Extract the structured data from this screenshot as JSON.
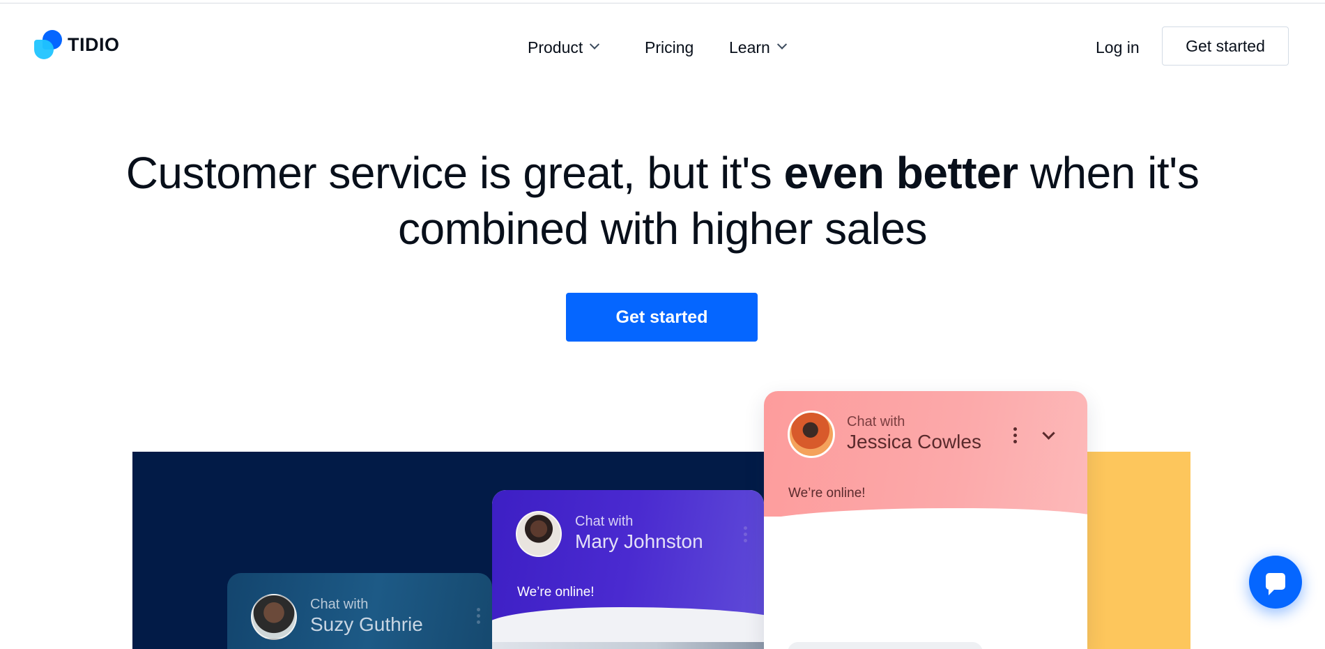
{
  "brand": {
    "name": "TIDIO"
  },
  "nav": {
    "product": "Product",
    "pricing": "Pricing",
    "learn": "Learn"
  },
  "header_actions": {
    "login": "Log in",
    "get_started": "Get started"
  },
  "hero": {
    "title_part1": "Customer service is great, but it's ",
    "title_bold": "even better",
    "title_part2": " when it's combined with higher sales",
    "cta": "Get started"
  },
  "chat_cards": {
    "suzy": {
      "chat_with": "Chat with",
      "name": "Suzy Guthrie"
    },
    "mary": {
      "chat_with": "Chat with",
      "name": "Mary Johnston",
      "status": "We’re online!"
    },
    "jessica": {
      "chat_with": "Chat with",
      "name": "Jessica Cowles",
      "status": "We’re online!"
    }
  },
  "colors": {
    "accent": "#0566ff",
    "text": "#080f1a",
    "navy": "#021b47",
    "yellow": "#fdc65c",
    "pink": "#fd9c9c",
    "purple": "#3d1fc4"
  },
  "icons": [
    "chevron-down-icon",
    "kebab-menu-icon",
    "chat-bubble-icon"
  ]
}
